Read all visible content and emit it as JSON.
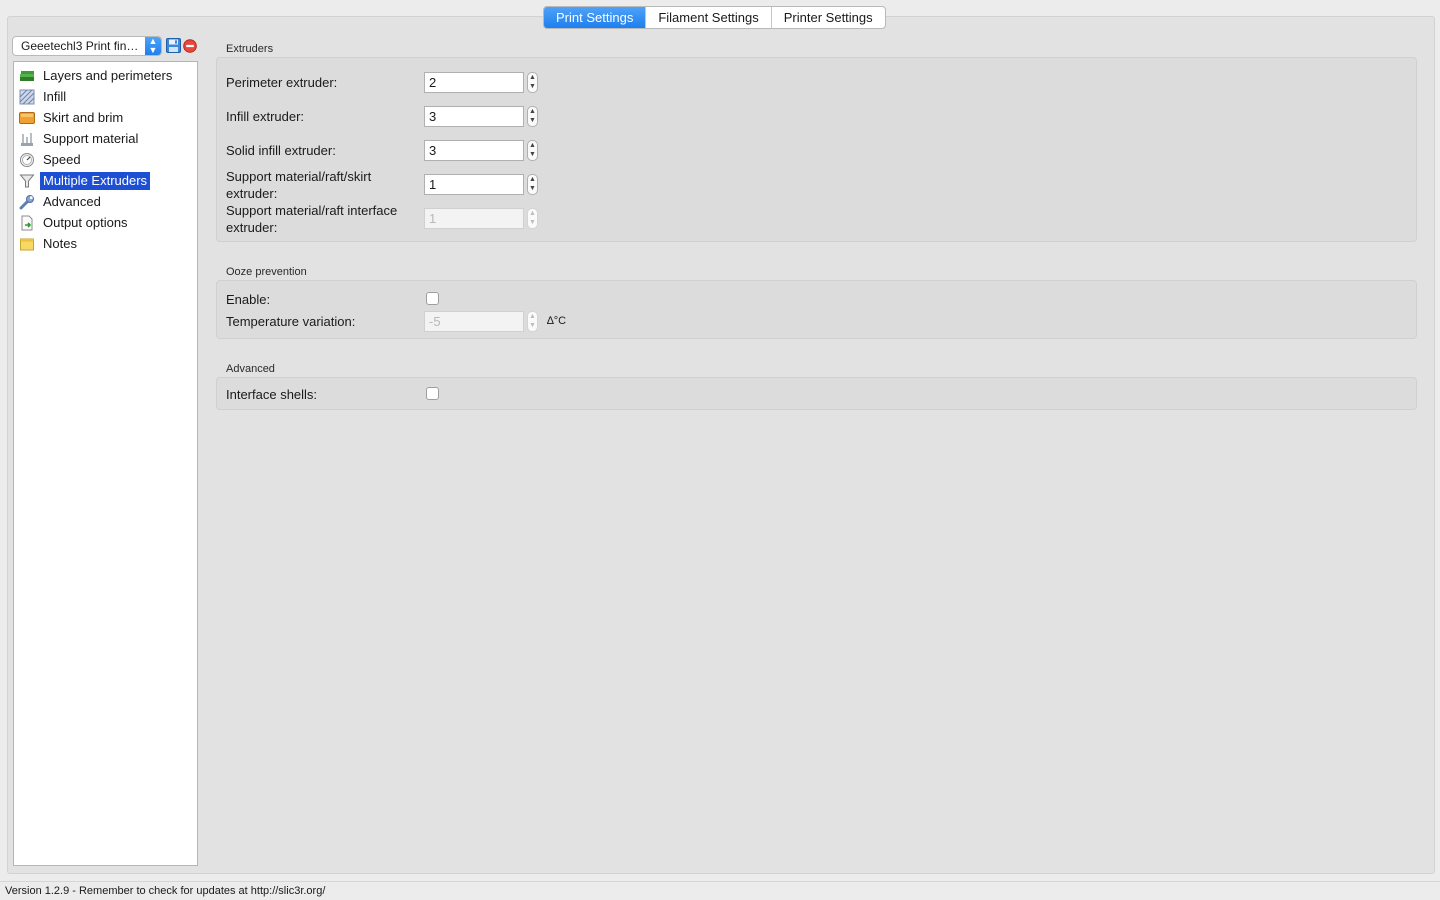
{
  "tabs": [
    {
      "label": "Print Settings",
      "active": true
    },
    {
      "label": "Filament Settings",
      "active": false
    },
    {
      "label": "Printer Settings",
      "active": false
    }
  ],
  "preset": {
    "selected": "Geeetechl3 Print finiti..."
  },
  "tree": [
    {
      "label": "Layers and perimeters",
      "icon": "layers-icon"
    },
    {
      "label": "Infill",
      "icon": "infill-icon"
    },
    {
      "label": "Skirt and brim",
      "icon": "skirt-icon"
    },
    {
      "label": "Support material",
      "icon": "support-icon"
    },
    {
      "label": "Speed",
      "icon": "speed-icon"
    },
    {
      "label": "Multiple Extruders",
      "icon": "funnel-icon",
      "selected": true
    },
    {
      "label": "Advanced",
      "icon": "wrench-icon"
    },
    {
      "label": "Output options",
      "icon": "output-icon"
    },
    {
      "label": "Notes",
      "icon": "notes-icon"
    }
  ],
  "extruders": {
    "title": "Extruders",
    "perimeter_label": "Perimeter extruder:",
    "perimeter_value": "2",
    "infill_label": "Infill extruder:",
    "infill_value": "3",
    "solid_infill_label": "Solid infill extruder:",
    "solid_infill_value": "3",
    "support_label_1": "Support material/raft/skirt",
    "support_label_2": "extruder:",
    "support_value": "1",
    "support_interface_label_1": "Support material/raft interface",
    "support_interface_label_2": "extruder:",
    "support_interface_value": "1"
  },
  "ooze": {
    "title": "Ooze prevention",
    "enable_label": "Enable:",
    "enable_checked": false,
    "temp_label": "Temperature variation:",
    "temp_value": "-5",
    "temp_unit": "∆°C"
  },
  "advanced": {
    "title": "Advanced",
    "interface_shells_label": "Interface shells:",
    "interface_shells_checked": false
  },
  "status": {
    "text": "Version 1.2.9 - Remember to check for updates at http://slic3r.org/"
  },
  "colors": {
    "accent": "#2f8ef5",
    "selection": "#1c4fd4"
  }
}
